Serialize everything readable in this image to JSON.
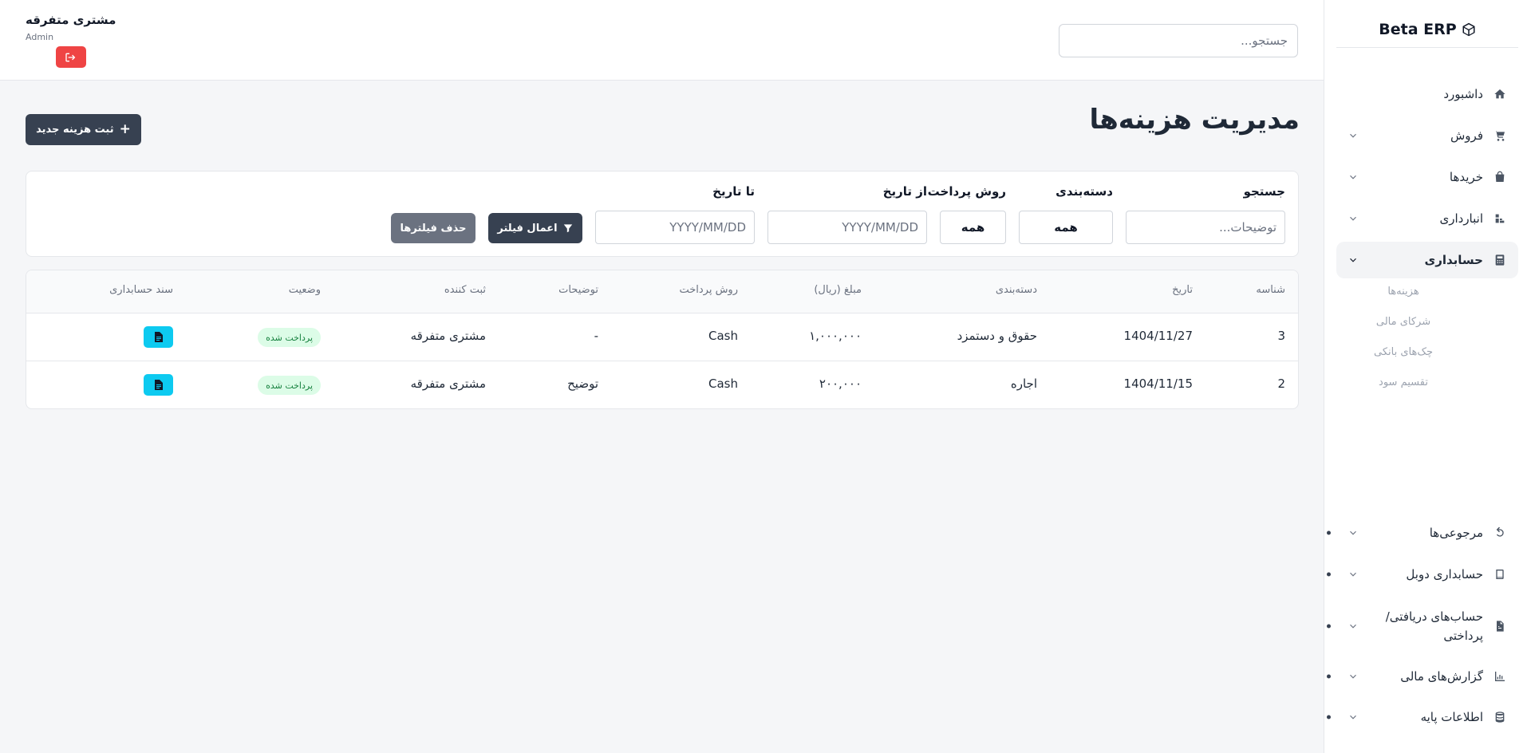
{
  "brand": {
    "name": "Beta ERP"
  },
  "sidebar": {
    "items": [
      {
        "label": "داشبورد",
        "icon": "home-icon"
      },
      {
        "label": "فروش",
        "icon": "cart-icon"
      },
      {
        "label": "خریدها",
        "icon": "shopping-bag-icon"
      },
      {
        "label": "انبارداری",
        "icon": "warehouse-icon"
      },
      {
        "label": "حسابداری",
        "icon": "calculator-icon"
      },
      {
        "label": "مرجوعی‌ها",
        "icon": "undo-icon"
      },
      {
        "label": "حسابداری دوبل",
        "icon": "book-icon"
      },
      {
        "label": "حساب‌های دریافتی/\nپرداختی",
        "icon": "invoice-icon"
      },
      {
        "label": "گزارش‌های مالی",
        "icon": "chart-icon"
      },
      {
        "label": "اطلاعات پایه",
        "icon": "database-icon"
      }
    ],
    "sub_items": [
      {
        "label": "هزینه‌ها"
      },
      {
        "label": "شرکای مالی"
      },
      {
        "label": "چک‌های بانکی"
      },
      {
        "label": "تقسیم سود"
      }
    ]
  },
  "topbar": {
    "search_placeholder": "جستجو...",
    "user_name": "مشتری متفرقه",
    "user_role": "Admin"
  },
  "page": {
    "title": "مدیریت هزینه‌ها",
    "add_button": "ثبت هزینه جدید"
  },
  "filters": {
    "search_label": "جستجو",
    "search_placeholder": "توضیحات...",
    "category_label": "دسته‌بندی",
    "category_value": "همه",
    "payment_label": "روش پرداخت",
    "payment_value": "همه",
    "from_label": "از تاریخ",
    "from_placeholder": "YYYY/MM/DD",
    "to_label": "تا تاریخ",
    "to_placeholder": "YYYY/MM/DD",
    "apply_button": "اعمال فیلتر",
    "clear_button": "حذف فیلترها"
  },
  "table": {
    "headers": [
      "شناسه",
      "تاریخ",
      "دسته‌بندی",
      "مبلغ (ریال)",
      "روش پرداخت",
      "توضیحات",
      "ثبت کننده",
      "وضعیت",
      "سند حسابداری"
    ],
    "rows": [
      {
        "id": "3",
        "date": "1404/11/27",
        "category": "حقوق و دستمزد",
        "amount": "۱,۰۰۰,۰۰۰",
        "method": "Cash",
        "description": "-",
        "creator": "مشتری متفرقه",
        "status": "پرداخت شده"
      },
      {
        "id": "2",
        "date": "1404/11/15",
        "category": "اجاره",
        "amount": "۲۰۰,۰۰۰",
        "method": "Cash",
        "description": "توضیح",
        "creator": "مشتری متفرقه",
        "status": "پرداخت شده"
      }
    ]
  }
}
